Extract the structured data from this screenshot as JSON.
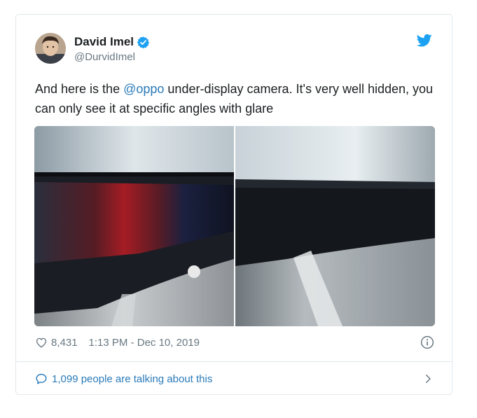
{
  "author": {
    "display_name": "David Imel",
    "handle": "@DurvidImel",
    "verified": true
  },
  "tweet": {
    "text_before": "And here is the ",
    "mention": "@oppo",
    "text_after": " under-display camera. It's very well hidden, you can only see it at specific angles with glare"
  },
  "meta": {
    "likes": "8,431",
    "timestamp": "1:13 PM - Dec 10, 2019"
  },
  "conversation": {
    "label": "1,099 people are talking about this"
  },
  "colors": {
    "twitter_blue": "#1da1f2",
    "link_blue": "#2b7bb9",
    "muted_gray": "#697882"
  },
  "icons": {
    "brand": "twitter-bird-icon",
    "verified": "verified-badge-icon",
    "like": "heart-icon",
    "info": "info-icon",
    "conversation": "speech-bubble-icon",
    "more": "chevron-right-icon"
  }
}
